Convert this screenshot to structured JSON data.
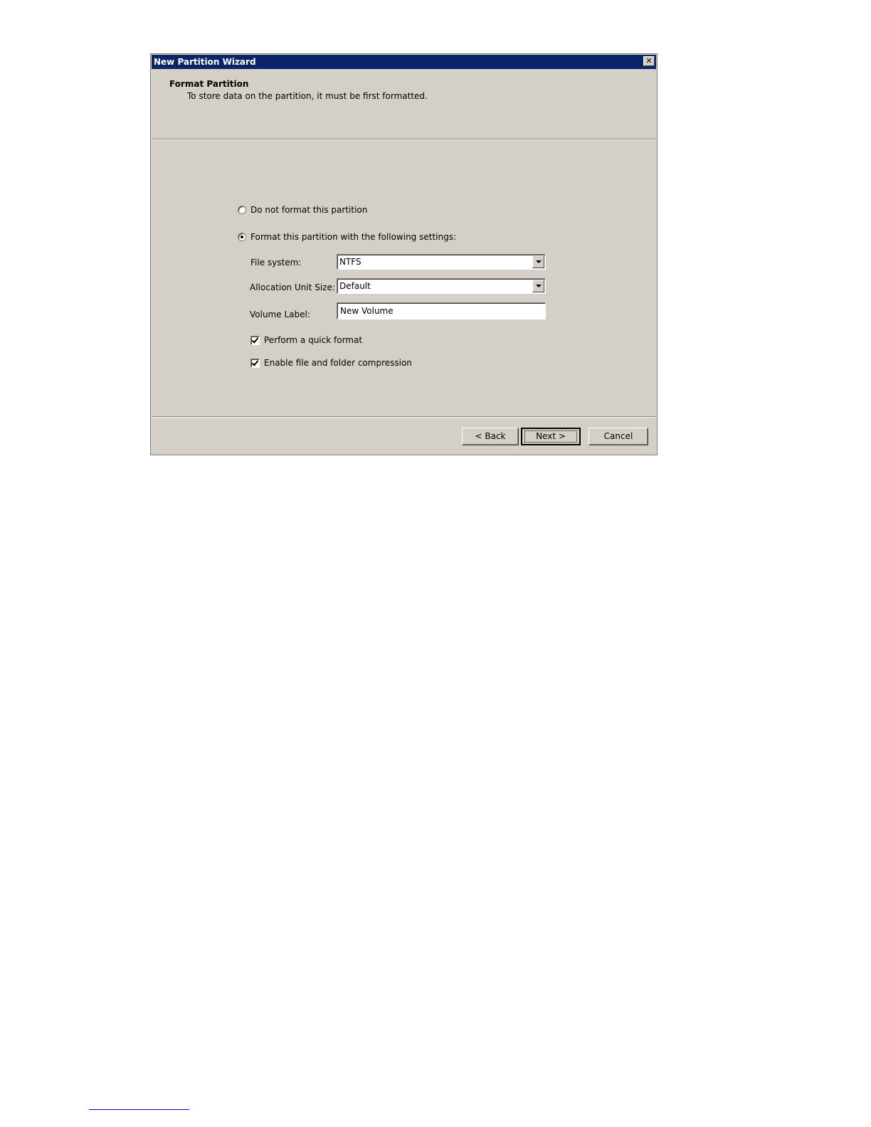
{
  "window": {
    "title": "New Partition Wizard",
    "close_glyph": "✕"
  },
  "header": {
    "title": "Format Partition",
    "subtitle": "To store data on the partition, it must be first formatted."
  },
  "options": {
    "no_format": {
      "label": "Do not format this partition",
      "selected": false
    },
    "format": {
      "label": "Format this partition with the following settings:",
      "selected": true
    }
  },
  "fields": {
    "file_system": {
      "label": "File system:",
      "value": "NTFS"
    },
    "allocation_unit": {
      "label": "Allocation Unit Size:",
      "value": "Default"
    },
    "volume_label": {
      "label": "Volume Label:",
      "value": "New Volume"
    }
  },
  "checkboxes": {
    "quick_format": {
      "label": "Perform a quick format",
      "checked": true
    },
    "compression": {
      "label": "Enable file and folder compression",
      "checked": true
    }
  },
  "buttons": {
    "back": "< Back",
    "next": "Next >",
    "cancel": "Cancel"
  },
  "icons": {
    "close": "close-icon",
    "dropdown": "chevron-down-icon"
  }
}
